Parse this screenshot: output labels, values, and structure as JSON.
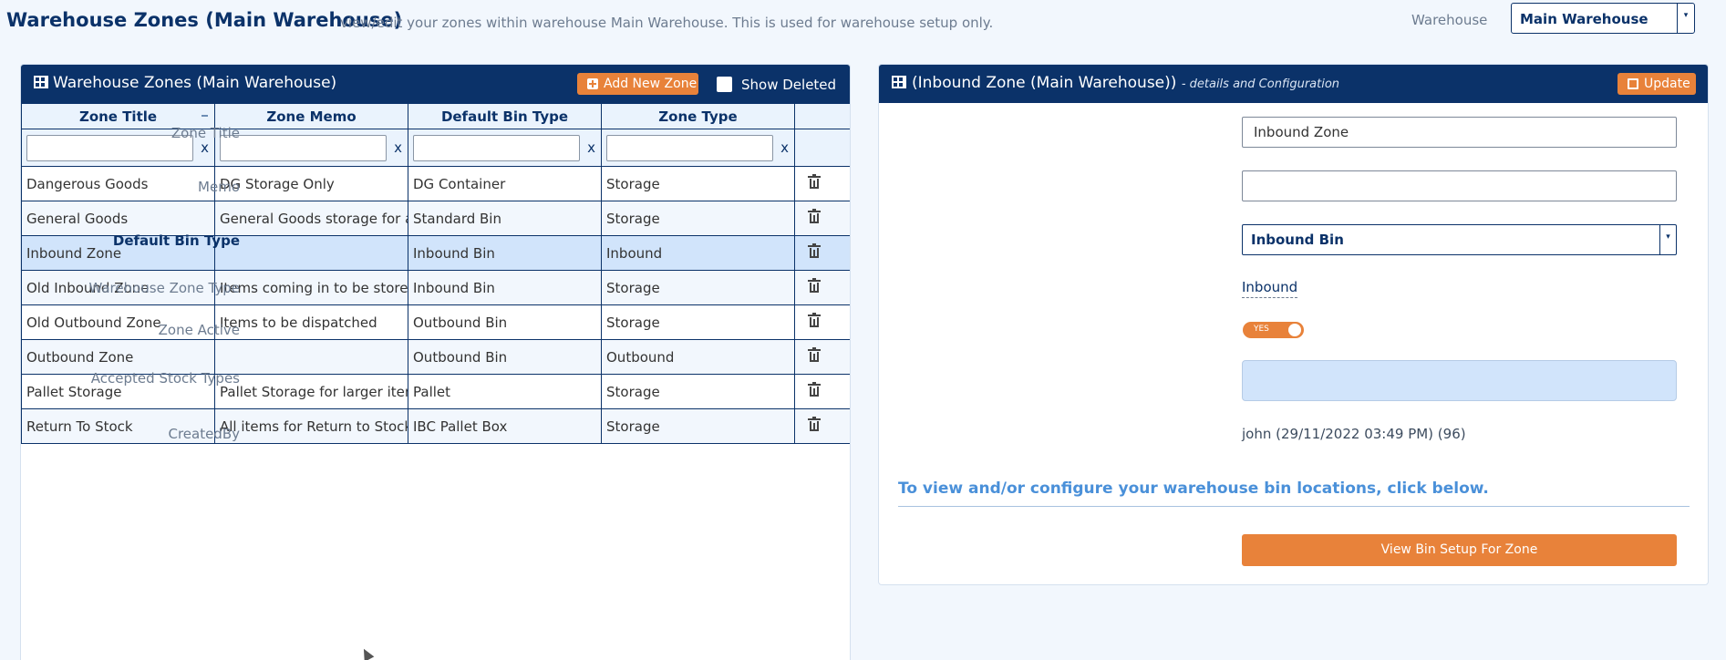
{
  "page": {
    "title": "Warehouse Zones (Main Warehouse)",
    "subtitle": "view/edit your zones within warehouse Main Warehouse. This is used for warehouse setup only.",
    "warehouse_label": "Warehouse",
    "warehouse_value": "Main Warehouse",
    "dropdown_arrow": "▾"
  },
  "left_panel": {
    "title": "Warehouse Zones (Main Warehouse)",
    "add_button": "Add New Zone",
    "show_deleted_label": "Show Deleted",
    "show_deleted_checked": false,
    "columns": [
      "Zone Title",
      "Zone Memo",
      "Default Bin Type",
      "Zone Type"
    ],
    "filter_clear": "x",
    "selected_row": "Inbound Zone",
    "rows": [
      {
        "title": "Dangerous Goods",
        "memo": "DG Storage Only",
        "bin": "DG Container",
        "type": "Storage"
      },
      {
        "title": "General Goods",
        "memo": "General Goods storage for all i",
        "bin": "Standard Bin",
        "type": "Storage"
      },
      {
        "title": "Inbound Zone",
        "memo": "",
        "bin": "Inbound Bin",
        "type": "Inbound"
      },
      {
        "title": "Old Inbound Zone",
        "memo": "Items coming in to be stored",
        "bin": "Inbound Bin",
        "type": "Storage"
      },
      {
        "title": "Old Outbound Zone",
        "memo": "Items to be dispatched",
        "bin": "Outbound Bin",
        "type": "Storage"
      },
      {
        "title": "Outbound Zone",
        "memo": "",
        "bin": "Outbound Bin",
        "type": "Outbound"
      },
      {
        "title": "Pallet Storage",
        "memo": "Pallet Storage for larger items",
        "bin": "Pallet",
        "type": "Storage"
      },
      {
        "title": "Return To Stock",
        "memo": "All items for Return to Stock go",
        "bin": "IBC Pallet Box",
        "type": "Storage"
      }
    ]
  },
  "right_panel": {
    "title": "(Inbound Zone (Main Warehouse))",
    "title_suffix": "- details and Configuration",
    "update_button": "Update",
    "zone_title_label": "Zone Title",
    "zone_title_value": "Inbound Zone",
    "memo_label": "Memo",
    "memo_value": "",
    "bin_type_label": "Default Bin Type",
    "bin_type_value": "Inbound Bin",
    "zone_type_label": "Warehouse Zone Type",
    "zone_type_value": "Inbound",
    "active_label": "Zone Active",
    "active_value": "YES",
    "stock_types_label": "Accepted Stock Types",
    "created_by_label": "CreatedBy",
    "created_by_value": "john (29/11/2022 03:49 PM) (96)",
    "note": "To view and/or configure your warehouse bin locations, click below.",
    "view_button": "View Bin Setup For Zone"
  },
  "colors": {
    "navy": "#0b3269",
    "accent_orange": "#e8823a",
    "selected_row": "#d1e4fb",
    "link_blue": "#4a90d9"
  }
}
